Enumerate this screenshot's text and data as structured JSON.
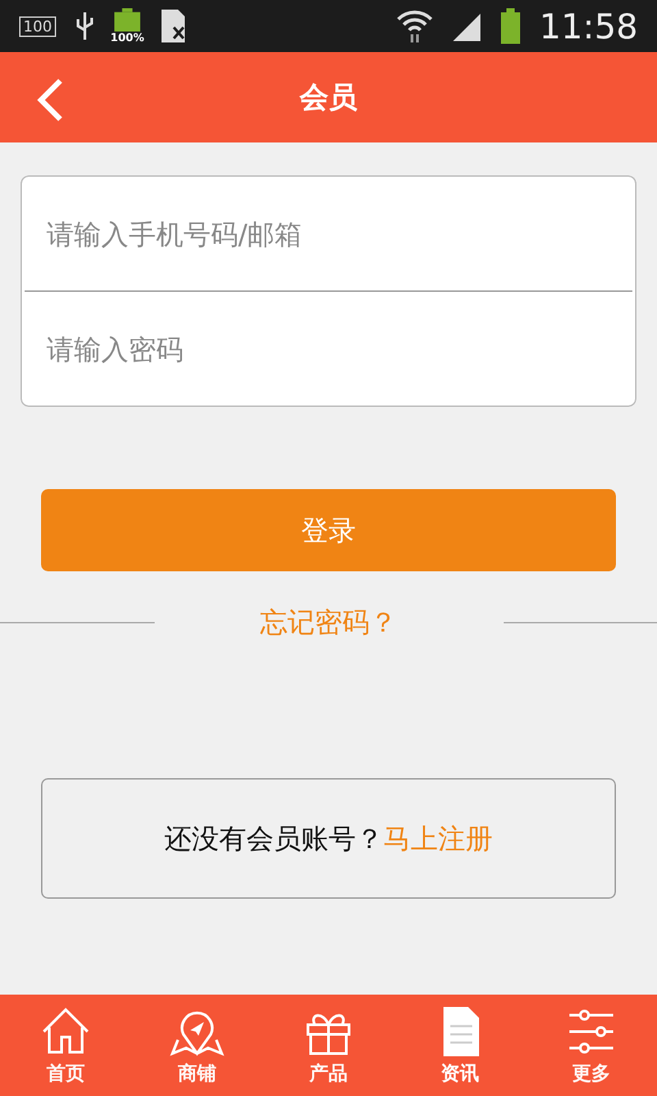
{
  "status_bar": {
    "storage_badge": "100",
    "battery_percent": "100%",
    "time": "11:58"
  },
  "header": {
    "title": "会员"
  },
  "login_form": {
    "account_field": {
      "placeholder": "请输入手机号码/邮箱"
    },
    "password_field": {
      "placeholder": "请输入密码"
    },
    "login_button": "登录",
    "forgot_link": "忘记密码？"
  },
  "register_prompt": {
    "text": "还没有会员账号？",
    "link": "马上注册"
  },
  "tab_bar": [
    {
      "kind": "home",
      "label": "首页",
      "selected": false
    },
    {
      "kind": "shop",
      "label": "商铺",
      "selected": false
    },
    {
      "kind": "product",
      "label": "产品",
      "selected": false
    },
    {
      "kind": "news",
      "label": "资讯",
      "selected": true
    },
    {
      "kind": "more",
      "label": "更多",
      "selected": false
    }
  ]
}
